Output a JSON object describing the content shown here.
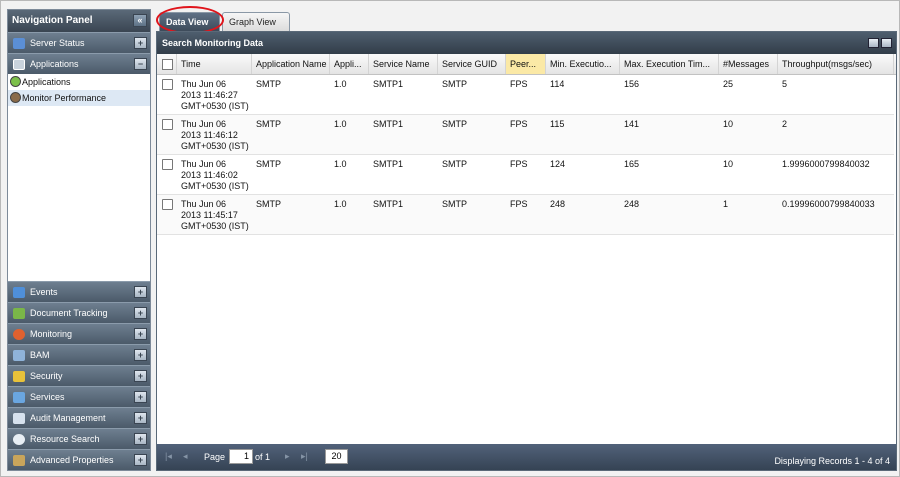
{
  "nav": {
    "title": "Navigation Panel",
    "sections_top": [
      {
        "label": "Server Status",
        "icon": "server-status-icon"
      },
      {
        "label": "Applications",
        "icon": "applications-icon"
      }
    ],
    "tree": [
      {
        "label": "Applications",
        "icon": "applications-node-icon"
      },
      {
        "label": "Monitor Performance",
        "icon": "monitor-performance-icon"
      }
    ],
    "sections_bottom": [
      {
        "label": "Events",
        "icon": "events-icon"
      },
      {
        "label": "Document Tracking",
        "icon": "document-tracking-icon"
      },
      {
        "label": "Monitoring",
        "icon": "monitoring-icon"
      },
      {
        "label": "BAM",
        "icon": "bam-icon"
      },
      {
        "label": "Security",
        "icon": "security-icon"
      },
      {
        "label": "Services",
        "icon": "services-icon"
      },
      {
        "label": "Audit Management",
        "icon": "audit-management-icon"
      },
      {
        "label": "Resource Search",
        "icon": "resource-search-icon"
      },
      {
        "label": "Advanced Properties",
        "icon": "advanced-properties-icon"
      }
    ]
  },
  "tabs": {
    "data_view": "Data View",
    "graph_view": "Graph View"
  },
  "grid": {
    "title": "Search Monitoring Data",
    "columns": [
      "Time",
      "Application Name",
      "Appli...",
      "Service Name",
      "Service GUID",
      "Peer...",
      "Min. Executio...",
      "Max. Execution Tim...",
      "#Messages",
      "Throughput(msgs/sec)"
    ],
    "rows": [
      {
        "time1": "Thu Jun 06",
        "time2": "2013 11:46:27",
        "time3": "GMT+0530 (IST)",
        "app": "SMTP",
        "ver": "1.0",
        "svc": "SMTP1",
        "guid": "SMTP",
        "peer": "FPS",
        "min": "114",
        "max": "156",
        "msgs": "25",
        "tput": "5"
      },
      {
        "time1": "Thu Jun 06",
        "time2": "2013 11:46:12",
        "time3": "GMT+0530 (IST)",
        "app": "SMTP",
        "ver": "1.0",
        "svc": "SMTP1",
        "guid": "SMTP",
        "peer": "FPS",
        "min": "115",
        "max": "141",
        "msgs": "10",
        "tput": "2"
      },
      {
        "time1": "Thu Jun 06",
        "time2": "2013 11:46:02",
        "time3": "GMT+0530 (IST)",
        "app": "SMTP",
        "ver": "1.0",
        "svc": "SMTP1",
        "guid": "SMTP",
        "peer": "FPS",
        "min": "124",
        "max": "165",
        "msgs": "10",
        "tput": "1.9996000799840032"
      },
      {
        "time1": "Thu Jun 06",
        "time2": "2013 11:45:17",
        "time3": "GMT+0530 (IST)",
        "app": "SMTP",
        "ver": "1.0",
        "svc": "SMTP1",
        "guid": "SMTP",
        "peer": "FPS",
        "min": "248",
        "max": "248",
        "msgs": "1",
        "tput": "0.19996000799840033"
      }
    ]
  },
  "pager": {
    "page_label": "Page",
    "page_value": "1",
    "of_label": "of 1",
    "page_size": "20",
    "status": "Displaying Records 1 - 4 of 4"
  },
  "colors": {
    "header_dark": "#3d4b5a",
    "highlight": "#e0141b",
    "peer_header": "#fbe9a6"
  }
}
